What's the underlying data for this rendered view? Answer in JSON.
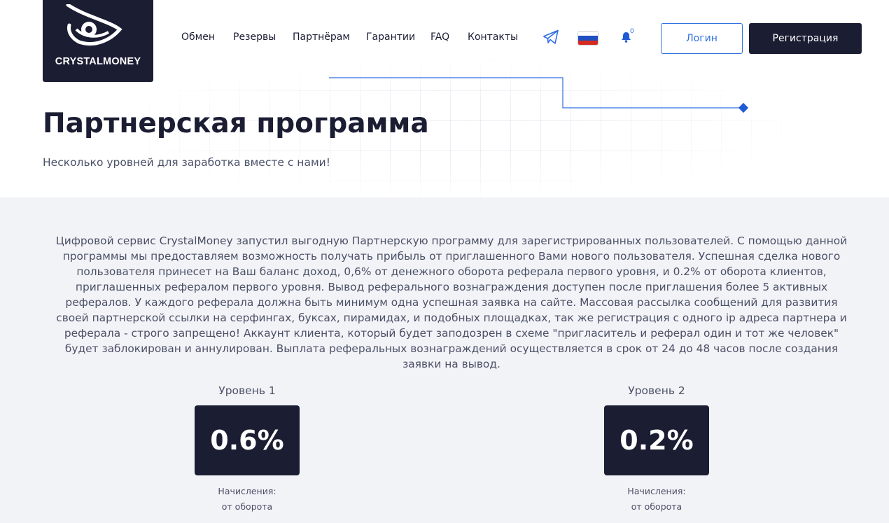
{
  "brand": {
    "name": "CRYSTALMONEY"
  },
  "nav": {
    "items": [
      "Обмен",
      "Резервы",
      "Партнёрам",
      "Гарантии",
      "FAQ",
      "Контакты"
    ]
  },
  "header_icons": {
    "telegram": "telegram-icon",
    "language": "russian-flag-icon",
    "notifications": "bell-icon",
    "notification_count": "0"
  },
  "auth": {
    "login_label": "Логин",
    "register_label": "Регистрация"
  },
  "hero": {
    "title": "Партнерская программа",
    "subtitle": "Несколько уровней для заработка вместе с нами!"
  },
  "description": "Цифровой сервис CrystalMoney запустил выгодную Партнерскую программу для зарегистрированных пользователей. С помощью данной программы мы предоставляем возможность получать прибыль от приглашенного Вами нового пользователя. Успешная сделка нового пользователя принесет на Ваш баланс доход, 0,6% от денежного оборота реферала первого уровня, и 0.2% от оборота клиентов, приглашенных рефералом первого уровня. Вывод реферального вознаграждения доступен после приглашения более 5 активных рефералов. У каждого реферала должна быть минимум одна успешная заявка на сайте. Массовая рассылка сообщений для развития своей партнерской ссылки на серфингах, буксах, пирамидах, и подобных площадках, так же регистрация с одного ip адреса партнера и реферала - строго запрещено! Аккаунт клиента, который будет заподозрен в схеме \"пригласитель и реферал один и тот же человек\" будет заблокирован и аннулирован.  Выплата реферальных вознаграждений осуществляется в срок от 24 до 48 часов после создания заявки на вывод.",
  "levels": [
    {
      "title": "Уровень 1",
      "value": "0.6%",
      "note_label": "Начисления:",
      "note_value": "от оборота"
    },
    {
      "title": "Уровень 2",
      "value": "0.2%",
      "note_label": "Начисления:",
      "note_value": "от оборота"
    }
  ],
  "colors": {
    "dark": "#1b1d33",
    "accent": "#2f6fe0",
    "background": "#f2f3f7"
  }
}
